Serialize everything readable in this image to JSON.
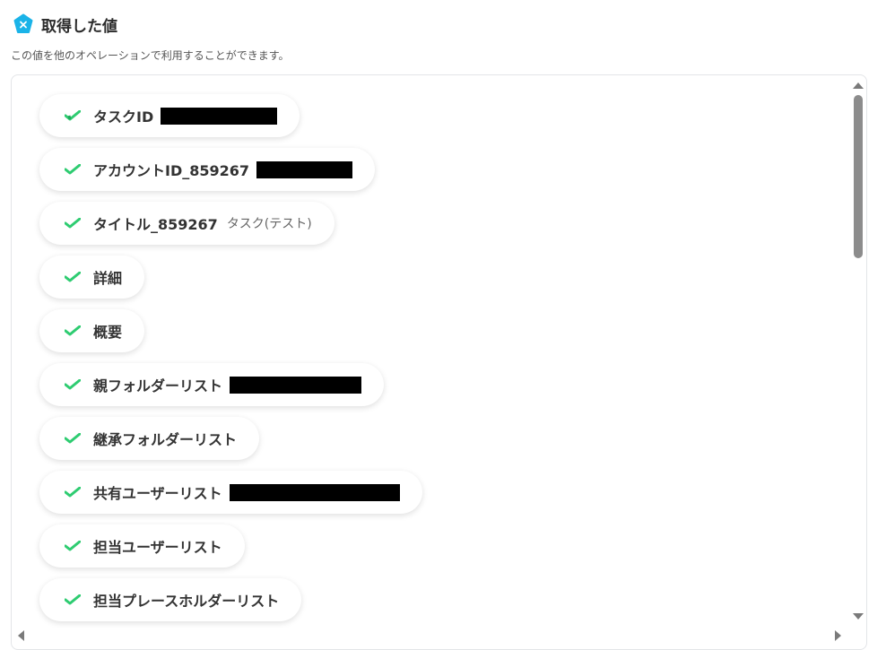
{
  "header": {
    "title": "取得した値",
    "badge_icon": "x-badge-icon",
    "badge_color": "#1ab3e8"
  },
  "subtitle": "この値を他のオペレーションで利用することができます。",
  "accent": "#2ecc71",
  "items": [
    {
      "label": "タスクID",
      "value": "",
      "redacted": true
    },
    {
      "label": "アカウントID_859267",
      "value": "",
      "redacted": true
    },
    {
      "label": "タイトル_859267",
      "value": "タスク(テスト)",
      "redacted": false
    },
    {
      "label": "詳細",
      "value": "",
      "redacted": false
    },
    {
      "label": "概要",
      "value": "",
      "redacted": false
    },
    {
      "label": "親フォルダーリスト",
      "value": "",
      "redacted": true
    },
    {
      "label": "継承フォルダーリスト",
      "value": "",
      "redacted": false
    },
    {
      "label": "共有ユーザーリスト",
      "value": "",
      "redacted": true
    },
    {
      "label": "担当ユーザーリスト",
      "value": "",
      "redacted": false
    },
    {
      "label": "担当プレースホルダーリスト",
      "value": "",
      "redacted": false
    }
  ]
}
